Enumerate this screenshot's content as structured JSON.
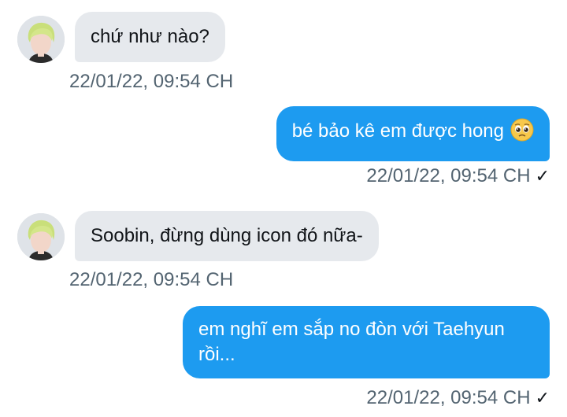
{
  "conversation": {
    "messages": [
      {
        "direction": "in",
        "text": "chứ như nào?",
        "time": "22/01/22, 09:54 CH"
      },
      {
        "direction": "out",
        "text": "bé bảo kê em được hong",
        "emoji": "pleading-face",
        "time": "22/01/22, 09:54 CH",
        "status": "✓"
      },
      {
        "direction": "in",
        "text": "Soobin, đừng dùng icon đó nữa-",
        "time": "22/01/22, 09:54 CH"
      },
      {
        "direction": "out",
        "text": "em nghĩ em sắp no đòn với Taehyun rồi...",
        "time": "22/01/22, 09:54 CH",
        "status": "✓"
      }
    ]
  },
  "colors": {
    "outgoing_bubble": "#1d9bf0",
    "incoming_bubble": "#e6e9ed",
    "timestamp": "#536471"
  }
}
